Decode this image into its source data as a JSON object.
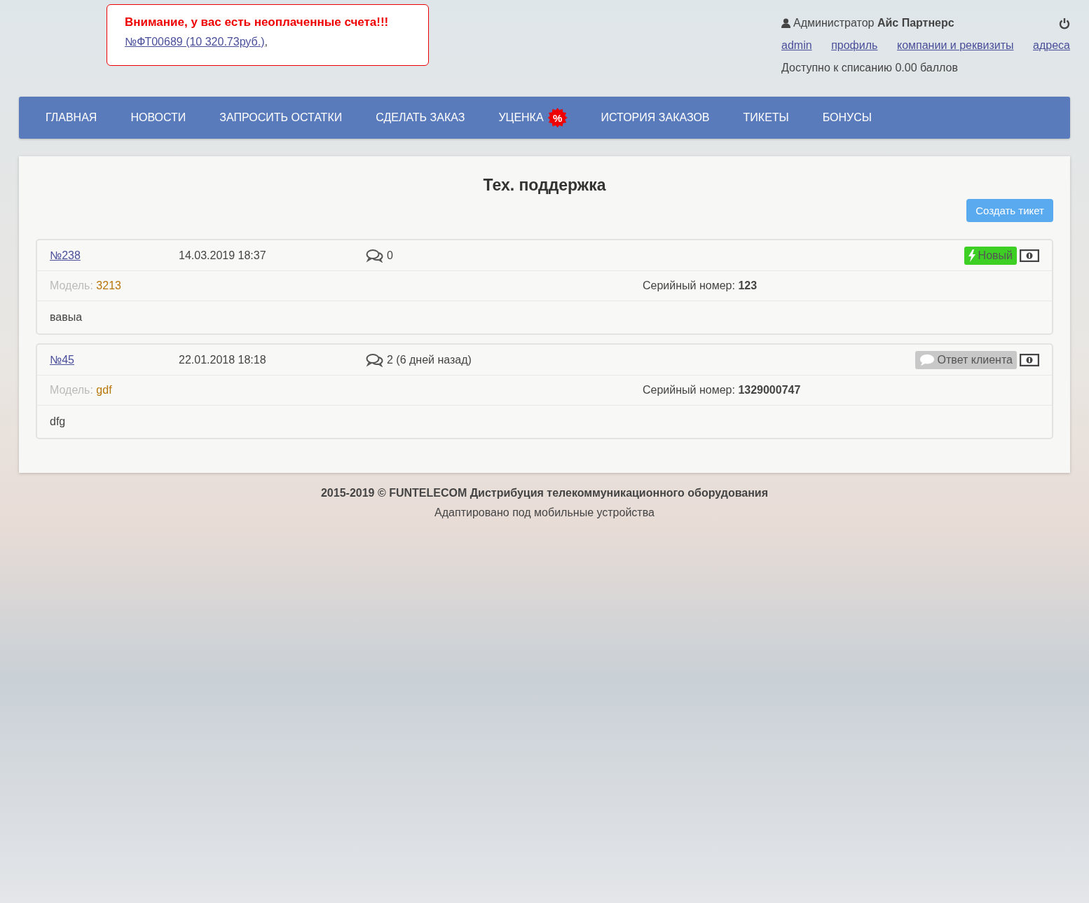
{
  "alert": {
    "title": "Внимание, у вас есть неоплаченные счета!!!",
    "invoices": [
      "№ФТ00689 (10 320.73руб.)"
    ],
    "separator": ","
  },
  "user": {
    "role": "Администратор",
    "company": "Айс Партнерс",
    "links": [
      "admin",
      "профиль",
      "компании и реквизиты",
      "адреса"
    ],
    "balance": "Доступно к списанию 0.00 баллов"
  },
  "nav": [
    {
      "label": "ГЛАВНАЯ"
    },
    {
      "label": "НОВОСТИ"
    },
    {
      "label": "ЗАПРОСИТЬ ОСТАТКИ"
    },
    {
      "label": "СДЕЛАТЬ ЗАКАЗ"
    },
    {
      "label": "УЦЕНКА",
      "badge": "%"
    },
    {
      "label": "ИСТОРИЯ ЗАКАЗОВ"
    },
    {
      "label": "ТИКЕТЫ"
    },
    {
      "label": "БОНУСЫ"
    }
  ],
  "page": {
    "title": "Тех. поддержка",
    "create_button": "Создать тикет"
  },
  "tickets": [
    {
      "number": "№238",
      "date": "14.03.2019 18:37",
      "comments": "0",
      "status": {
        "kind": "new",
        "label": "Новый"
      },
      "model_label": "Модель:",
      "model": "3213",
      "serial_label": "Серийный номер:",
      "serial": "123",
      "text": "вавыа"
    },
    {
      "number": "№45",
      "date": "22.01.2018 18:18",
      "comments": "2 (6 дней назад)",
      "status": {
        "kind": "client_reply",
        "label": "Ответ клиента"
      },
      "model_label": "Модель:",
      "model": "gdf",
      "serial_label": "Серийный номер:",
      "serial": "1329000747",
      "text": "dfg"
    }
  ],
  "footer": {
    "copyright": "2015-2019 © FUNTELECOM Дистрибуция телекоммуникационного оборудования",
    "note": "Адаптировано под мобильные устройства"
  }
}
